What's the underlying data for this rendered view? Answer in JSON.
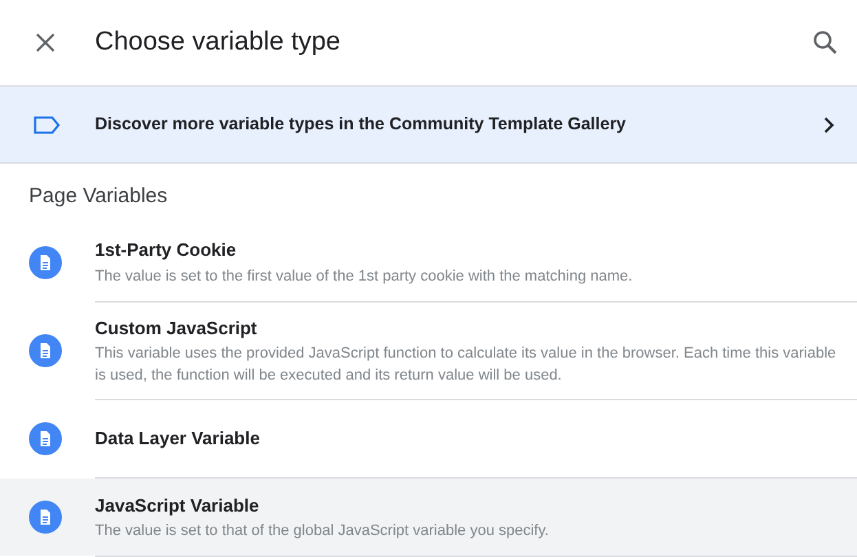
{
  "header": {
    "title": "Choose variable type"
  },
  "banner": {
    "text": "Discover more variable types in the Community Template Gallery"
  },
  "section": {
    "title": "Page Variables"
  },
  "items": [
    {
      "title": "1st-Party Cookie",
      "description": "The value is set to the first value of the 1st party cookie with the matching name.",
      "highlighted": false
    },
    {
      "title": "Custom JavaScript",
      "description": "This variable uses the provided JavaScript function to calculate its value in the browser. Each time this variable is used, the function will be executed and its return value will be used.",
      "highlighted": false
    },
    {
      "title": "Data Layer Variable",
      "highlighted": false
    },
    {
      "title": "JavaScript Variable",
      "description": "The value is set to that of the global JavaScript variable you specify.",
      "highlighted": true
    }
  ]
}
